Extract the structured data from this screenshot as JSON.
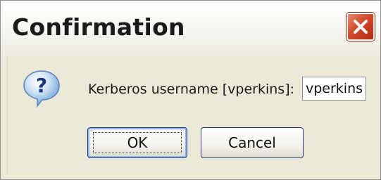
{
  "dialog": {
    "title": "Confirmation",
    "prompt": "Kerberos username [vperkins]:",
    "username_value": "vperkins",
    "ok_label": "OK",
    "cancel_label": "Cancel"
  },
  "icons": {
    "close": "close-icon",
    "question": "question-icon"
  },
  "colors": {
    "close_button": "#d24a2a",
    "dialog_background": "#ece9d8",
    "button_border": "#1f3c7a"
  }
}
